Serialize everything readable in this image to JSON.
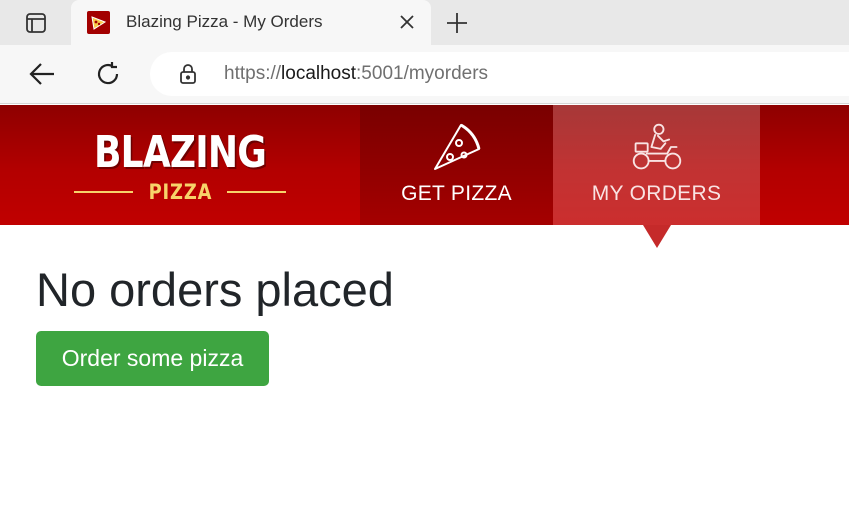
{
  "browser": {
    "tab_title": "Blazing Pizza - My Orders",
    "url": {
      "scheme": "https://",
      "host": "localhost",
      "rest": ":5001/myorders"
    }
  },
  "site": {
    "logo": {
      "main": "BLAZING",
      "sub": "PIZZA"
    },
    "nav": {
      "get_pizza": "GET PIZZA",
      "my_orders": "MY ORDERS",
      "active": "my_orders"
    },
    "colors": {
      "header_red": "#b30000",
      "logo_gold": "#f7d36a",
      "button_green": "#3ea541",
      "text_dark": "#212529"
    }
  },
  "main": {
    "heading": "No orders placed",
    "order_button_label": "Order some pizza"
  },
  "icons": {
    "tab_actions": "tab-actions-icon",
    "favicon": "pizza-slice-icon",
    "close": "close-icon",
    "new_tab": "plus-icon",
    "back": "back-arrow-icon",
    "refresh": "refresh-icon",
    "lock": "lock-icon",
    "get_pizza": "pizza-slice-icon",
    "my_orders": "delivery-rider-icon"
  }
}
